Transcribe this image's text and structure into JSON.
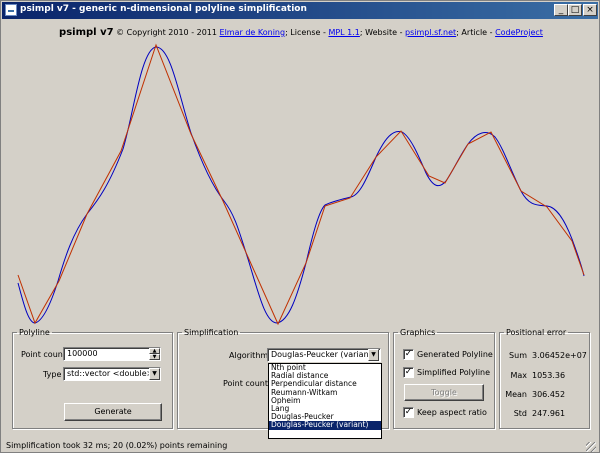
{
  "window": {
    "title": "psimpl v7 - generic n-dimensional polyline simplification"
  },
  "header": {
    "app_name": "psimpl v7",
    "copyright": "© Copyright 2010 - 2011",
    "author_link": "Elmar de Koning",
    "license_prefix": "; License -",
    "license_link": "MPL 1.1",
    "website_prefix": "; Website -",
    "website_link": "psimpl.sf.net",
    "article_prefix": "; Article -",
    "article_link": "CodeProject"
  },
  "polyline": {
    "group_label": "Polyline",
    "point_count_label": "Point count",
    "point_count_value": "100000",
    "type_label": "Type",
    "type_value": "std::vector <double>",
    "generate_button": "Generate"
  },
  "simplification": {
    "group_label": "Simplification",
    "algorithm_label": "Algorithm",
    "algorithm_value": "Douglas-Peucker (variant)",
    "point_count_label": "Point count",
    "algorithm_options": [
      "Nth point",
      "Radial distance",
      "Perpendicular distance",
      "Reumann-Witkam",
      "Opheim",
      "Lang",
      "Douglas-Peucker",
      "Douglas-Peucker (variant)"
    ]
  },
  "graphics": {
    "group_label": "Graphics",
    "generated_polyline_label": "Generated Polyline",
    "generated_polyline_checked": true,
    "simplified_polyline_label": "Simplified Polyline",
    "simplified_polyline_checked": true,
    "toggle_button": "Toggle",
    "keep_aspect_ratio_label": "Keep aspect ratio",
    "keep_aspect_ratio_checked": true
  },
  "positional_error": {
    "group_label": "Positional error",
    "sum_label": "Sum",
    "sum_value": "3.06452e+07",
    "max_label": "Max",
    "max_value": "1053.36",
    "mean_label": "Mean",
    "mean_value": "306.452",
    "std_label": "Std",
    "std_value": "247.961"
  },
  "status": {
    "text": "Simplification took 32 ms; 20 (0.02%) points remaining"
  },
  "colors": {
    "generated_polyline": "#0000c0",
    "simplified_polyline": "#c03000",
    "title_bar": "#0a246a"
  },
  "icons": {
    "minimize": "minimize-icon",
    "maximize": "maximize-icon",
    "close": "close-icon"
  }
}
